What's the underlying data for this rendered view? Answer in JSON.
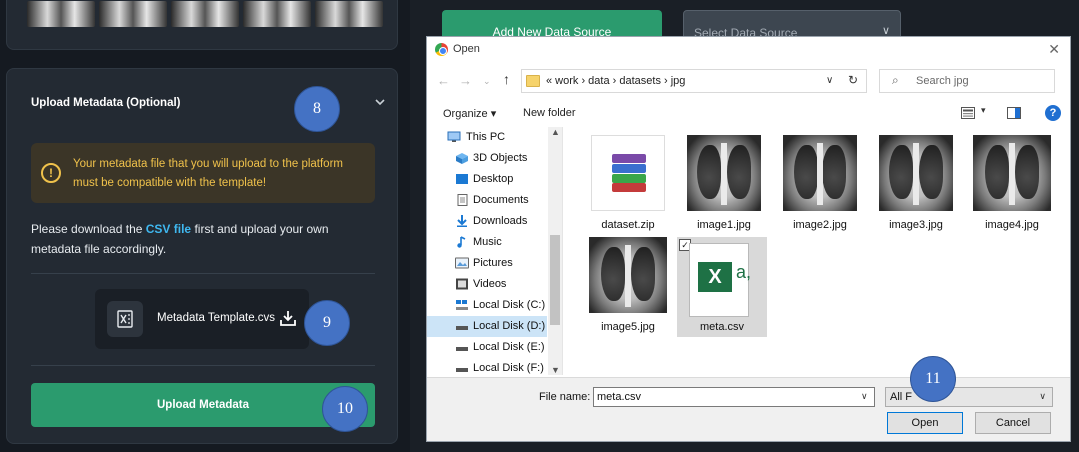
{
  "left": {
    "meta_title": "Upload Metadata (Optional)",
    "warning_text": "Your metadata file that you will upload to the platform must be compatible with the template!",
    "download_before": "Please download the ",
    "csv_link": "CSV file",
    "download_after": " first and upload your own metadata file accordingly.",
    "template_name": "Metadata Template.cvs",
    "upload_button": "Upload Metadata"
  },
  "steps": {
    "s8": "8",
    "s9": "9",
    "s10": "10",
    "s11": "11"
  },
  "top": {
    "add_source": "Add New Data Source",
    "select_source": "Select Data Source"
  },
  "dialog": {
    "title": "Open",
    "path": "« work  ›  data  ›  datasets  ›  jpg",
    "search_placeholder": "Search jpg",
    "organize": "Organize ▾",
    "new_folder": "New folder",
    "nav": [
      {
        "label": "This PC",
        "icon": "pc-icon"
      },
      {
        "label": "3D Objects",
        "icon": "cube-icon"
      },
      {
        "label": "Desktop",
        "icon": "desktop-icon"
      },
      {
        "label": "Documents",
        "icon": "documents-icon"
      },
      {
        "label": "Downloads",
        "icon": "download-icon"
      },
      {
        "label": "Music",
        "icon": "music-icon"
      },
      {
        "label": "Pictures",
        "icon": "pictures-icon"
      },
      {
        "label": "Videos",
        "icon": "videos-icon"
      },
      {
        "label": "Local Disk (C:)",
        "icon": "disk-icon"
      },
      {
        "label": "Local Disk (D:)",
        "icon": "disk-icon"
      },
      {
        "label": "Local Disk (E:)",
        "icon": "disk-icon"
      },
      {
        "label": "Local Disk (F:)",
        "icon": "disk-icon"
      }
    ],
    "files": [
      {
        "name": "dataset.zip",
        "icon": "zip-icon"
      },
      {
        "name": "image1.jpg",
        "icon": "xray-thumbnail"
      },
      {
        "name": "image2.jpg",
        "icon": "xray-thumbnail"
      },
      {
        "name": "image3.jpg",
        "icon": "xray-thumbnail"
      },
      {
        "name": "image4.jpg",
        "icon": "xray-thumbnail"
      },
      {
        "name": "image5.jpg",
        "icon": "xray-thumbnail"
      },
      {
        "name": "meta.csv",
        "icon": "excel-icon"
      }
    ],
    "file_name_label": "File name:",
    "file_name_value": "meta.csv",
    "file_type": "All F",
    "open_button": "Open",
    "cancel_button": "Cancel"
  },
  "colors": {
    "accent_green": "#2b9b6e",
    "step_blue": "#4472c4",
    "warning_text": "#f0c24b",
    "link_blue": "#3fb8f0",
    "panel_bg": "#232a33"
  }
}
